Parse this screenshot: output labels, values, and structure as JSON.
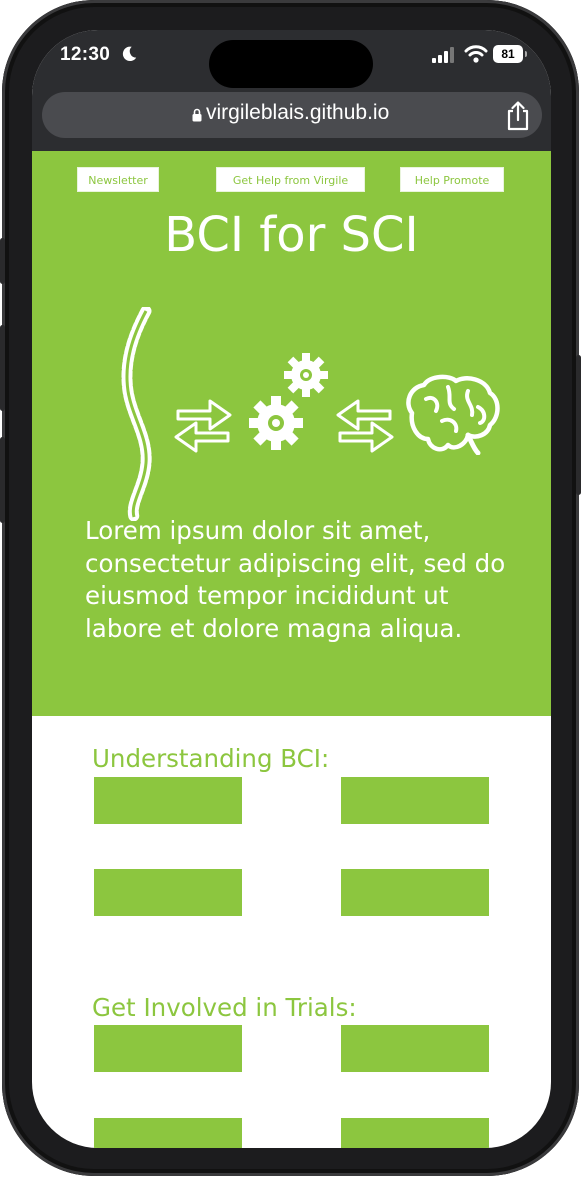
{
  "status_bar": {
    "time": "12:30",
    "battery": "81"
  },
  "browser": {
    "url": "virgileblais.github.io"
  },
  "nav": {
    "newsletter": "Newsletter",
    "get_help": "Get Help from Virgile",
    "help_promote": "Help Promote"
  },
  "hero": {
    "title": "BCI for SCI",
    "body": "Lorem ipsum dolor sit amet, consectetur adipiscing elit, sed do eiusmod tempor incididunt ut labore et dolore magna aliqua.",
    "icons": [
      "spine-icon",
      "arrows-icon",
      "gears-icon",
      "arrows-icon",
      "brain-icon"
    ]
  },
  "sections": {
    "understanding": {
      "title": "Understanding BCI:"
    },
    "trials": {
      "title": "Get Involved in Trials:"
    }
  },
  "colors": {
    "brand_green": "#8cc63f",
    "chrome_dark": "#2c2d30"
  }
}
